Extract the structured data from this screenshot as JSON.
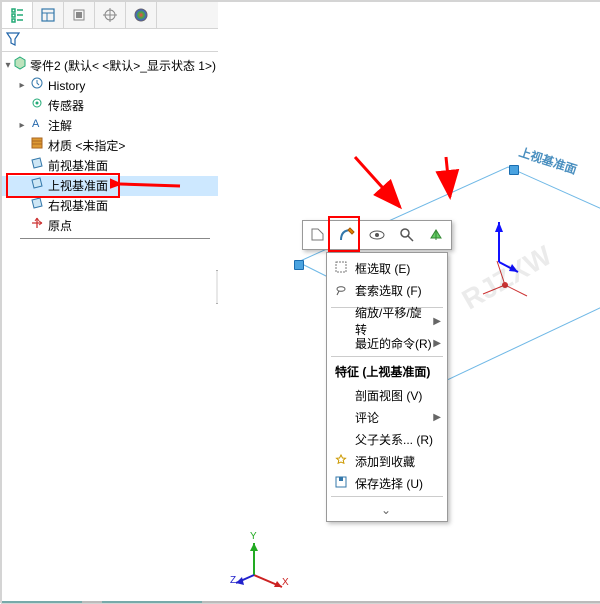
{
  "tree": {
    "root": "零件2  (默认< <默认>_显示状态 1>)",
    "history": "History",
    "sensors": "传感器",
    "annotations": "注解",
    "material": "材质 <未指定>",
    "front": "前视基准面",
    "top": "上视基准面",
    "right": "右视基准面",
    "origin": "原点"
  },
  "context": {
    "box_select": "框选取 (E)",
    "lasso_select": "套索选取 (F)",
    "zoom_pan": "缩放/平移/旋转",
    "recent": "最近的命令(R)",
    "feature_header": "特征 (上视基准面)",
    "section_view": "剖面视图 (V)",
    "comment": "评论",
    "parent_child": "父子关系... (R)",
    "add_fav": "添加到收藏",
    "save_sel": "保存选择 (U)"
  },
  "plane_label": "上视基准面",
  "axes": {
    "x": "X",
    "y": "Y",
    "z": "Z"
  }
}
